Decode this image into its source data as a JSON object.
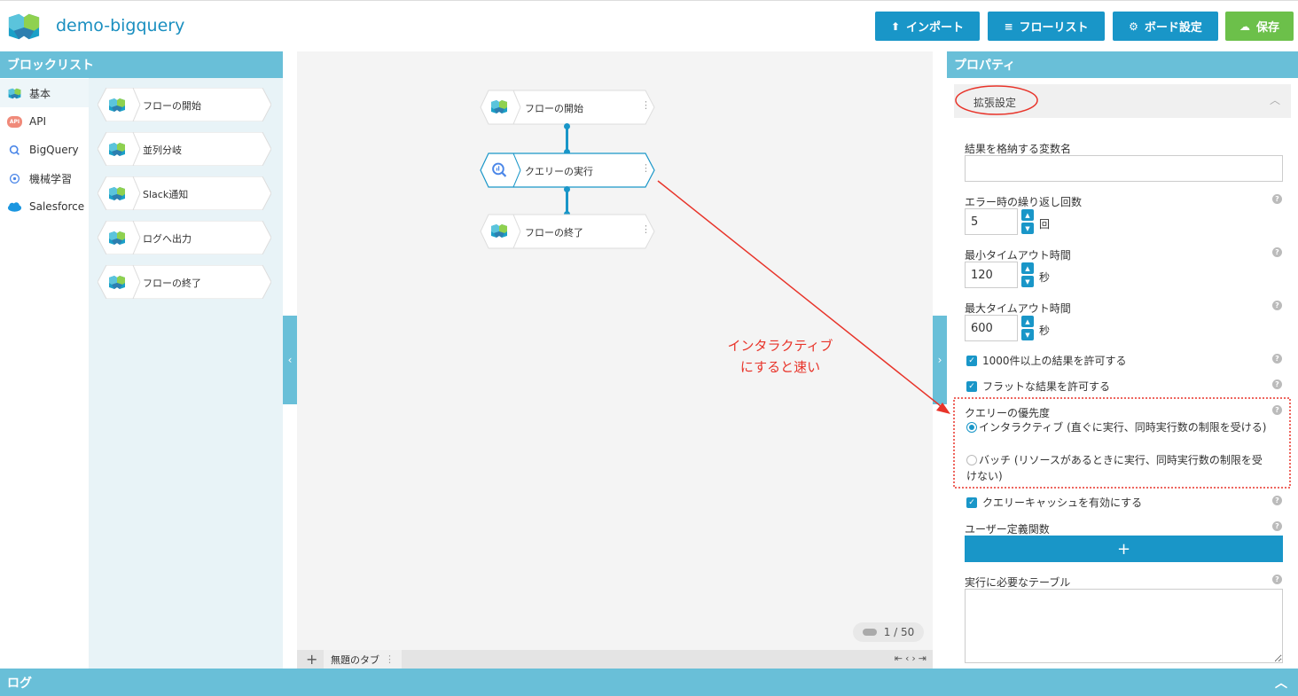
{
  "app": {
    "title": "demo-bigquery"
  },
  "toolbar": {
    "import_label": "インポート",
    "flowlist_label": "フローリスト",
    "board_settings_label": "ボード設定",
    "save_label": "保存"
  },
  "left": {
    "header": "ブロックリスト",
    "categories": [
      {
        "label": "基本",
        "icon": "flow-cube-icon"
      },
      {
        "label": "API",
        "icon": "api-badge-icon"
      },
      {
        "label": "BigQuery",
        "icon": "bigquery-icon"
      },
      {
        "label": "機械学習",
        "icon": "brain-icon"
      },
      {
        "label": "Salesforce",
        "icon": "salesforce-cloud-icon"
      }
    ],
    "blocks": [
      {
        "label": "フローの開始"
      },
      {
        "label": "並列分岐"
      },
      {
        "label": "Slack通知"
      },
      {
        "label": "ログへ出力"
      },
      {
        "label": "フローの終了"
      }
    ]
  },
  "canvas": {
    "nodes": [
      {
        "label": "フローの開始"
      },
      {
        "label": "クエリーの実行"
      },
      {
        "label": "フローの終了"
      }
    ],
    "page_counter": "1 / 50",
    "tab_label": "無題のタブ"
  },
  "properties": {
    "header": "プロパティ",
    "section_title": "拡張設定",
    "result_var_label": "結果を格納する変数名",
    "result_var_value": "",
    "retry_label": "エラー時の繰り返し回数",
    "retry_value": "5",
    "retry_unit": "回",
    "min_timeout_label": "最小タイムアウト時間",
    "min_timeout_value": "120",
    "min_timeout_unit": "秒",
    "max_timeout_label": "最大タイムアウト時間",
    "max_timeout_value": "600",
    "max_timeout_unit": "秒",
    "allow_large_label": "1000件以上の結果を許可する",
    "allow_flat_label": "フラットな結果を許可する",
    "priority_label": "クエリーの優先度",
    "priority_interactive": "インタラクティブ (直ぐに実行、同時実行数の制限を受ける)",
    "priority_batch": "バッチ (リソースがあるときに実行、同時実行数の制限を受けない)",
    "query_cache_label": "クエリーキャッシュを有効にする",
    "udf_label": "ユーザー定義関数",
    "udf_add": "+",
    "tables_label": "実行に必要なテーブル"
  },
  "log": {
    "header": "ログ"
  },
  "annotation": {
    "line1": "インタラクティブ",
    "line2": "にすると速い"
  },
  "colors": {
    "accent": "#1996c8",
    "bar": "#69bfd8",
    "save": "#6cc04a",
    "annotation": "#e8342a"
  }
}
